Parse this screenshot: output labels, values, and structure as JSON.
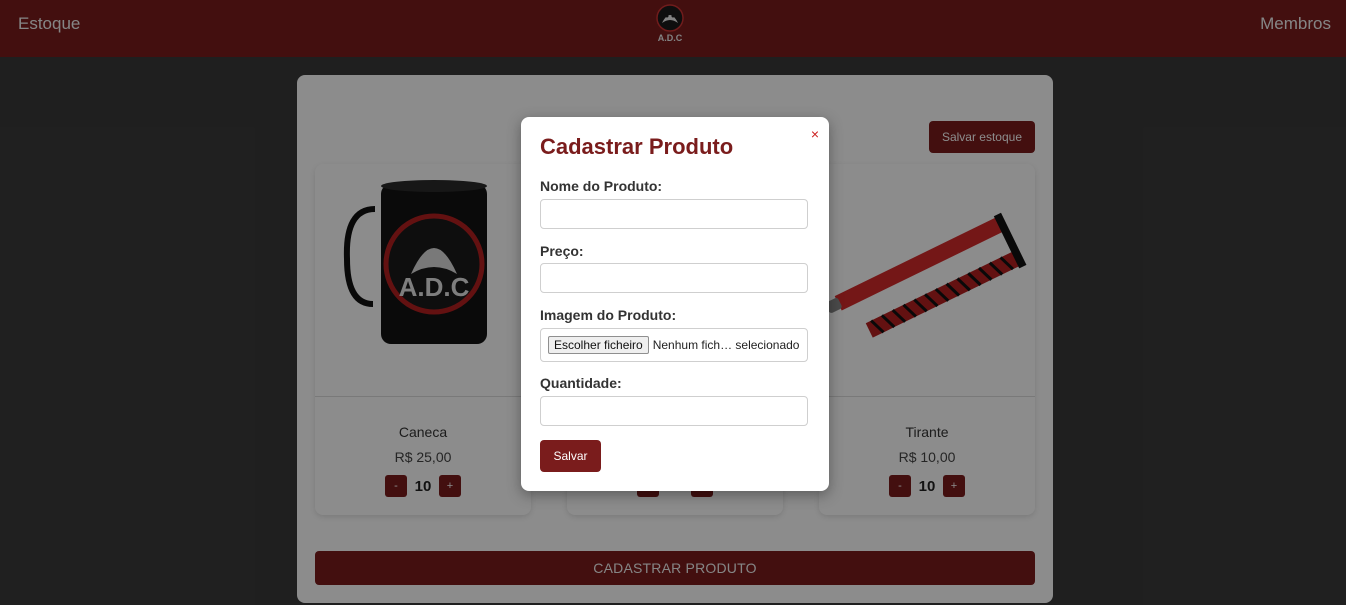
{
  "header": {
    "nav_left": "Estoque",
    "nav_right": "Membros",
    "logo_text": "A.D.C"
  },
  "panel": {
    "save_stock_label": "Salvar estoque",
    "register_label": "CADASTRAR PRODUTO"
  },
  "products": [
    {
      "name": "Caneca",
      "price": "R$ 25,00",
      "qty": "10",
      "minus": "-",
      "plus": "+",
      "icon": "mug-icon"
    },
    {
      "name": "",
      "price": "",
      "qty": "",
      "minus": "-",
      "plus": "+",
      "icon": "product-icon"
    },
    {
      "name": "Tirante",
      "price": "R$ 10,00",
      "qty": "10",
      "minus": "-",
      "plus": "+",
      "icon": "lanyard-icon"
    }
  ],
  "modal": {
    "title": "Cadastrar Produto",
    "close": "×",
    "name_label": "Nome do Produto:",
    "price_label": "Preço:",
    "image_label": "Imagem do Produto:",
    "file_button": "Escolher ficheiro",
    "file_status": "Nenhum fich… selecionado",
    "qty_label": "Quantidade:",
    "submit": "Salvar"
  },
  "colors": {
    "brand": "#7a1c1c",
    "close": "#cc2020"
  }
}
